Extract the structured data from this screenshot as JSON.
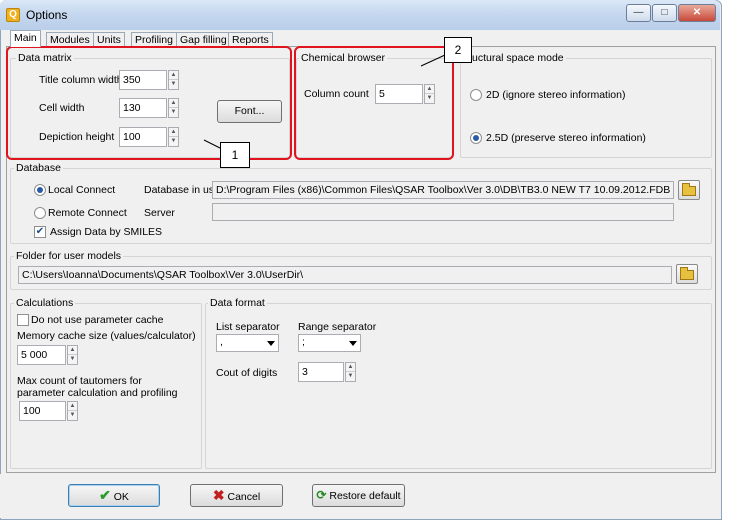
{
  "window": {
    "title": "Options",
    "app_icon": "Q"
  },
  "tabs": [
    {
      "label": "Main"
    },
    {
      "label": "Modules"
    },
    {
      "label": "Units"
    },
    {
      "label": "Profiling"
    },
    {
      "label": "Gap filling"
    },
    {
      "label": "Reports"
    }
  ],
  "data_matrix": {
    "legend": "Data matrix",
    "title_column_width_label": "Title column width",
    "title_column_width": "350",
    "cell_width_label": "Cell width",
    "cell_width": "130",
    "depiction_height_label": "Depiction height",
    "depiction_height": "100",
    "font_button": "Font..."
  },
  "chemical_browser": {
    "legend": "Chemical browser",
    "column_count_label": "Column count",
    "column_count": "5"
  },
  "structural_space": {
    "legend": "uctural space mode",
    "option_2d": "2D  (ignore stereo information)",
    "option_25d": "2.5D (preserve stereo information)",
    "selected": "2.5D"
  },
  "database": {
    "legend": "Database",
    "local_connect": "Local Connect",
    "remote_connect": "Remote Connect",
    "database_in_use_label": "Database in use",
    "database_in_use": "D:\\Program Files (x86)\\Common Files\\QSAR Toolbox\\Ver 3.0\\DB\\TB3.0 NEW T7 10.09.2012.FDB",
    "server_label": "Server",
    "server": "",
    "assign_by_smiles": "Assign Data by SMILES"
  },
  "user_models": {
    "legend": "Folder for user models",
    "path": "C:\\Users\\Ioanna\\Documents\\QSAR Toolbox\\Ver 3.0\\UserDir\\"
  },
  "calculations": {
    "legend": "Calculations",
    "no_cache": "Do not use parameter cache",
    "memory_cache_label": "Memory cache size (values/calculator)",
    "memory_cache": "5 000",
    "tautomers_label_1": "Max count of tautomers for",
    "tautomers_label_2": "parameter calculation and profiling",
    "tautomers": "100"
  },
  "data_format": {
    "legend": "Data format",
    "list_separator_label": "List separator",
    "list_separator": ",",
    "range_separator_label": "Range separator",
    "range_separator": ";",
    "digits_label": "Cout of digits",
    "digits": "3"
  },
  "buttons": {
    "ok": "OK",
    "cancel": "Cancel",
    "restore": "Restore default"
  },
  "callouts": {
    "one": "1",
    "two": "2"
  },
  "colors": {
    "highlight": "#e0141e",
    "ok_check": "#2a9a2a",
    "cancel_x": "#c02020"
  }
}
